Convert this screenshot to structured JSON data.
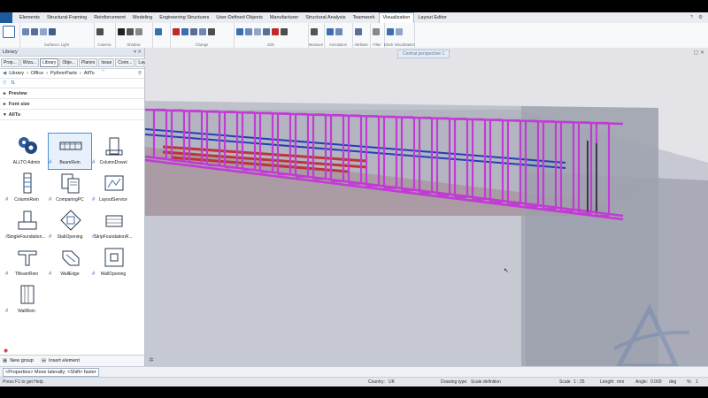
{
  "menu": {
    "tabs": [
      "Elements",
      "Structural Framing",
      "Reinforcement",
      "Modeling",
      "Engineering Structures",
      "User-Defined Objects",
      "Manufacturer",
      "Structural Analysis",
      "Teamwork",
      "Visualization",
      "Layout Editor"
    ],
    "active_index": 9
  },
  "ribbon": {
    "groups": [
      "Surfaces, Light",
      "Camera",
      "Shadow",
      "Change",
      "Edit",
      "Measure",
      "Annotation",
      "Attribute",
      "Filter",
      "Block Visualization"
    ]
  },
  "panel": {
    "title": "Library",
    "tabs": [
      "Prop...",
      "Wiza...",
      "Library",
      "Obje...",
      "Planes",
      "Issue ...",
      "Conn...",
      "Layers"
    ],
    "active_tab": 2,
    "path": [
      "Library",
      "Office",
      "PythonParts",
      "AllTo"
    ],
    "sections": [
      "Preview",
      "Font size",
      "AllTo"
    ],
    "items": [
      "ALLTO Admin",
      "BeamRein",
      "ColumnDowel",
      "ColumnRein",
      "ComparingPC",
      "LayoutService",
      "SingleFoundation...",
      "SlabOpening",
      "StripFoundationR...",
      "TBeamRein",
      "WallEdge",
      "WallOpening",
      "WallRein"
    ],
    "selected_item": 1,
    "footer": {
      "new_group": "New group",
      "insert_element": "Insert element"
    }
  },
  "viewport": {
    "tab_label": "Central perspective 1"
  },
  "status": {
    "hint": "<Properties> Move laterally; <Shift> faster"
  },
  "infobar": {
    "help": "Press F1 to get Help.",
    "country_label": "Country:",
    "country_value": "UK",
    "drawing_type_label": "Drawing type:",
    "drawing_type_value": "Scale definition",
    "scale_label": "Scale",
    "scale_value": "1 : 25",
    "length_label": "Length:",
    "length_unit": "mm",
    "angle_label": "Angle:",
    "angle_value": "0.000",
    "angle_unit": "deg",
    "extra_label": "%:",
    "extra_value": "1"
  },
  "colors": {
    "rebar_stirrup": "#c23bd4",
    "rebar_longitudinal": "#1f3fb8",
    "rebar_red": "#c0282a",
    "concrete": "#c8cad4",
    "accent": "#1e5aa0"
  },
  "icons": [
    "allplan-logo",
    "help-icon",
    "settings-icon",
    "close-icon",
    "back-arrow-icon",
    "search-icon",
    "filter-icon",
    "sort-icon",
    "new-group-icon",
    "insert-element-icon",
    "compass-icon"
  ]
}
